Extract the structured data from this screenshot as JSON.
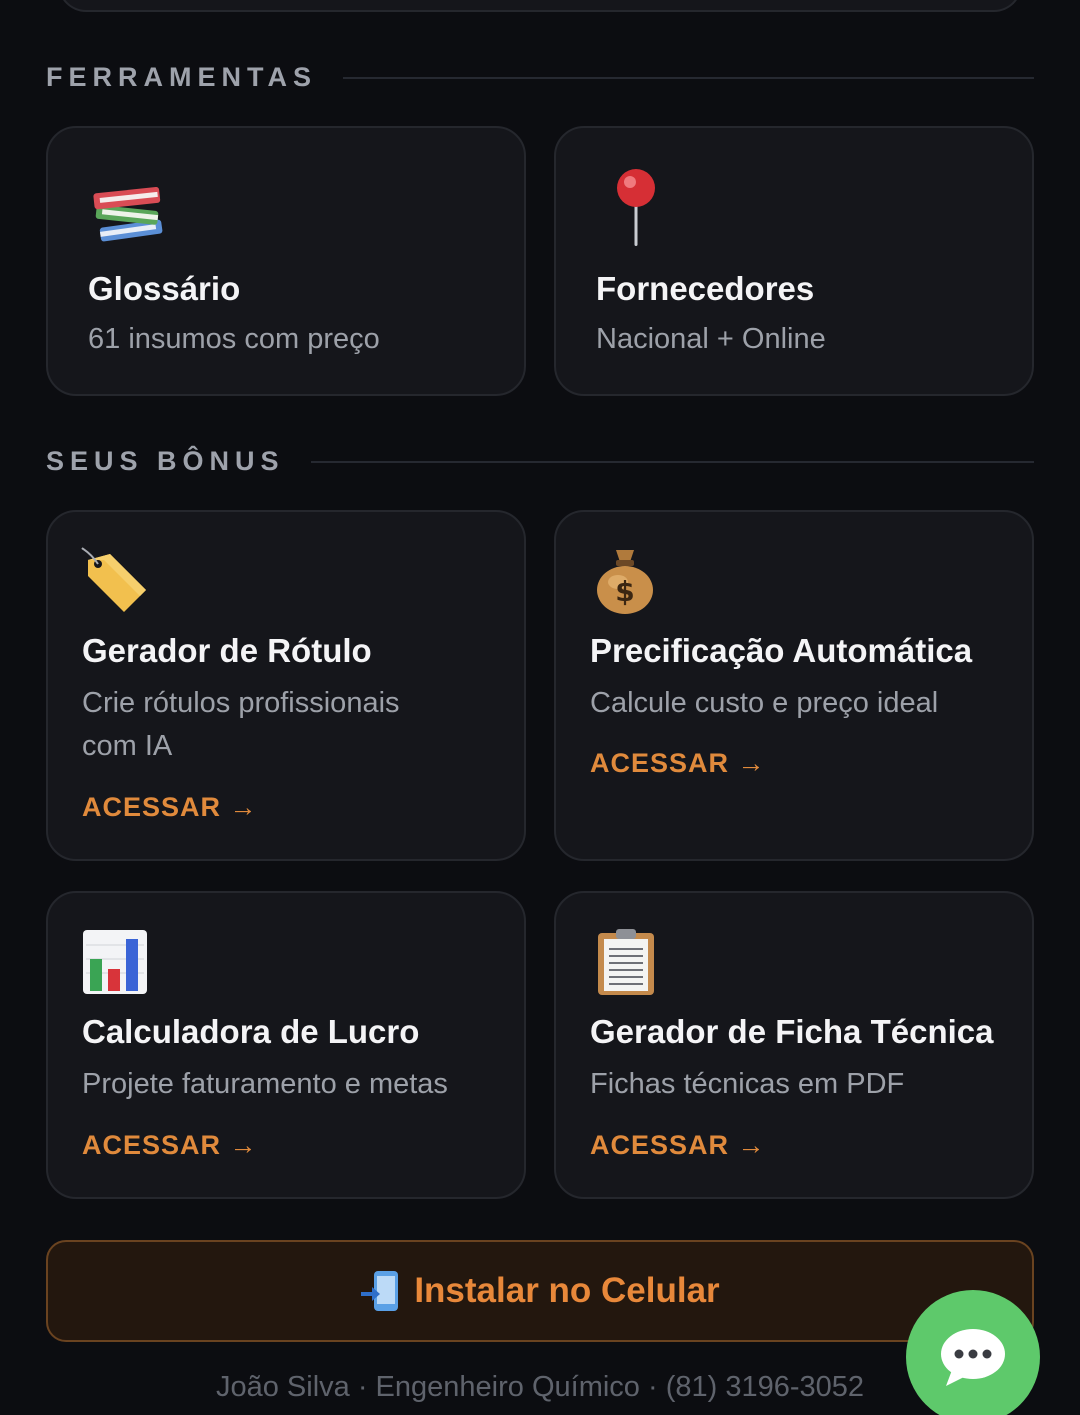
{
  "sections": {
    "tools_title": "FERRAMENTAS",
    "bonus_title": "SEUS BÔNUS"
  },
  "tools": [
    {
      "icon": "books-icon",
      "title": "Glossário",
      "desc": "61 insumos com preço"
    },
    {
      "icon": "pushpin-icon",
      "title": "Fornecedores",
      "desc": "Nacional + Online"
    }
  ],
  "bonuses": [
    {
      "icon": "label-tag-icon",
      "title": "Gerador de Rótulo",
      "desc_line1": "Crie rótulos profissionais",
      "desc_line2": "com IA",
      "cta": "ACESSAR →"
    },
    {
      "icon": "money-bag-icon",
      "title": "Precificação Automática",
      "desc_line1": "Calcule custo e preço ideal",
      "cta": "ACESSAR →"
    },
    {
      "icon": "bar-chart-icon",
      "title": "Calculadora de Lucro",
      "desc_line1": "Projete faturamento e metas",
      "cta": "ACESSAR →"
    },
    {
      "icon": "clipboard-icon",
      "title": "Gerador de Ficha Técnica",
      "desc_line1": "Fichas técnicas em PDF",
      "cta": "ACESSAR →"
    }
  ],
  "install": {
    "icon": "mobile-arrow-icon",
    "label": "Instalar no Celular"
  },
  "footer": {
    "text": "João Silva · Engenheiro Químico · (81) 3196-3052"
  },
  "chat": {
    "icon": "speech-bubble-icon"
  },
  "colors": {
    "accent": "#e08a3c",
    "background": "#0c0d11",
    "card": "#15161b",
    "chat_green": "#5ec96b"
  }
}
